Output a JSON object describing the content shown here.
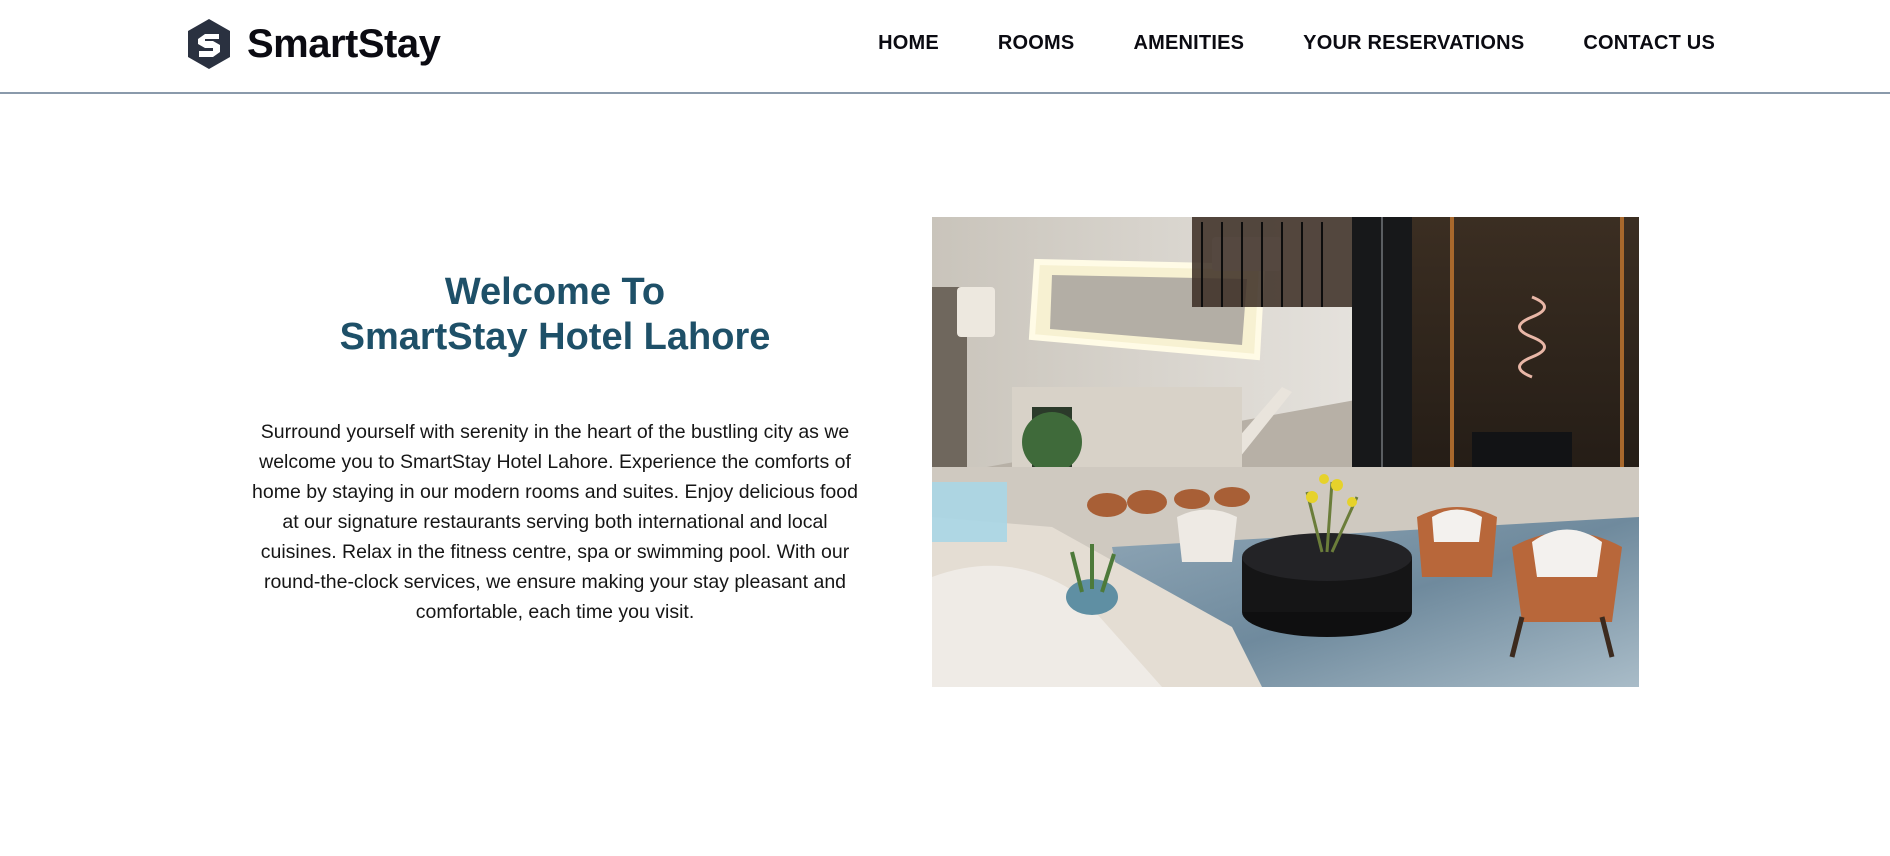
{
  "brand": {
    "name": "SmartStay",
    "logo_icon": "hexagon-s-logo-icon"
  },
  "nav": {
    "items": [
      {
        "label": "HOME"
      },
      {
        "label": "ROOMS"
      },
      {
        "label": "AMENITIES"
      },
      {
        "label": "YOUR RESERVATIONS"
      },
      {
        "label": "CONTACT US"
      }
    ]
  },
  "hero": {
    "title_line1": "Welcome To",
    "title_line2": "SmartStay Hotel Lahore",
    "body": "Surround yourself with serenity in the heart of the bustling city as we welcome you to SmartStay Hotel Lahore. Experience the comforts of home by staying in our modern rooms and suites. Enjoy delicious food at our signature restaurants serving both international and local cuisines. Relax in the fitness centre, spa or swimming pool. With our round-the-clock services, we ensure making your stay pleasant and comfortable, each time you visit.",
    "image": "hotel-lounge-photo"
  },
  "colors": {
    "title": "#1e5068",
    "nav_text": "#0b0b12",
    "header_border": "#8a9aab",
    "logo_mark": "#2a3140"
  }
}
